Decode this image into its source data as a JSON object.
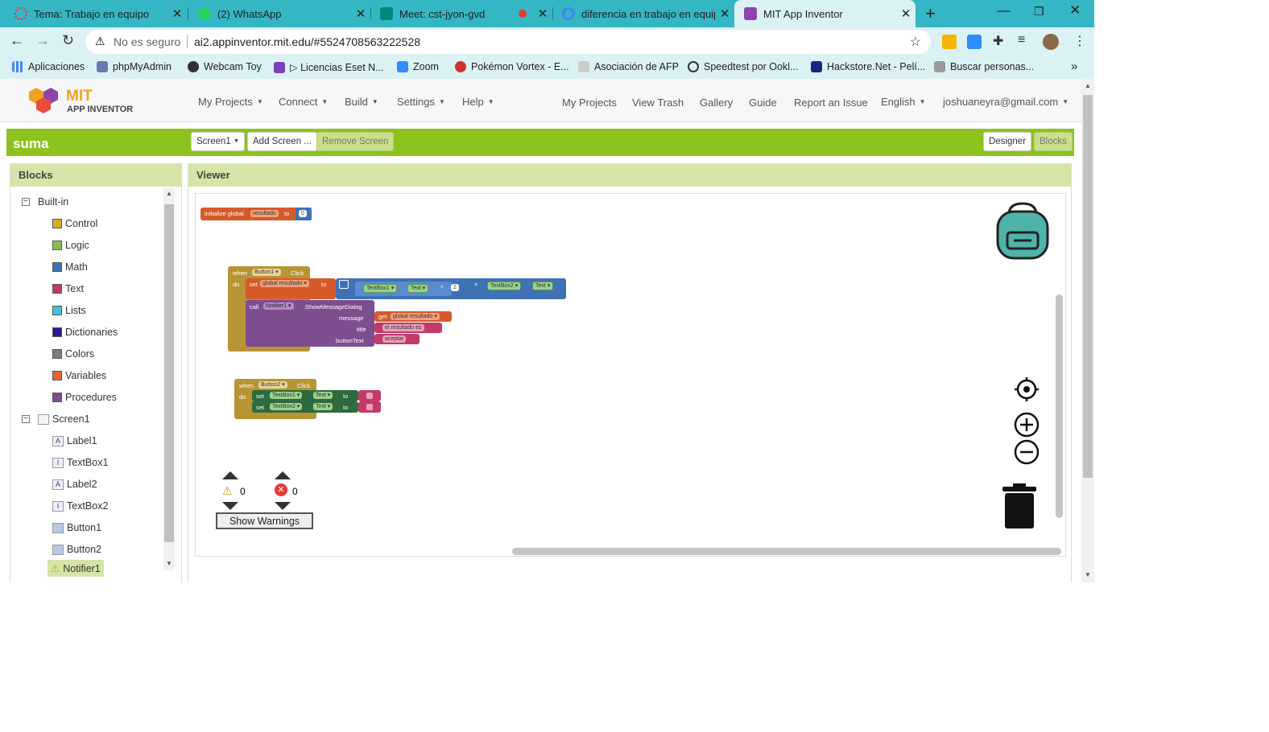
{
  "tabs": [
    {
      "title": "Tema: Trabajo en equipo",
      "icon": "loading-icon"
    },
    {
      "title": "(2) WhatsApp",
      "icon": "whatsapp-icon"
    },
    {
      "title": "Meet: cst-jyon-gvd",
      "icon": "meet-icon"
    },
    {
      "title": "diferencia en trabajo en equipo",
      "icon": "google-icon"
    },
    {
      "title": "MIT App Inventor",
      "icon": "appinventor-icon"
    }
  ],
  "address": {
    "security": "No es seguro",
    "url": "ai2.appinventor.mit.edu/#5524708563222528"
  },
  "bookmarks": [
    "Aplicaciones",
    "phpMyAdmin",
    "Webcam Toy",
    "▷ Licencias Eset N...",
    "Zoom",
    "Pokémon Vortex - E...",
    "Asociación de AFP",
    "Speedtest por Ookl...",
    "Hackstore.Net - Pelí...",
    "Buscar personas..."
  ],
  "app": {
    "logo_top": "MIT",
    "logo_bottom": "APP INVENTOR",
    "menus": [
      "My Projects",
      "Connect",
      "Build",
      "Settings",
      "Help"
    ],
    "links": [
      "My Projects",
      "View Trash",
      "Gallery",
      "Guide",
      "Report an Issue"
    ],
    "language": "English",
    "user": "joshuaneyra@gmail.com"
  },
  "project": {
    "name": "suma",
    "screen": "Screen1",
    "add_screen": "Add Screen ...",
    "remove_screen": "Remove Screen",
    "designer": "Designer",
    "blocks": "Blocks"
  },
  "blocks_panel": {
    "title": "Blocks",
    "builtin": "Built-in",
    "categories": [
      {
        "label": "Control",
        "color": "#e0a82e"
      },
      {
        "label": "Logic",
        "color": "#8cbd4a"
      },
      {
        "label": "Math",
        "color": "#3f71b5"
      },
      {
        "label": "Text",
        "color": "#c33969"
      },
      {
        "label": "Lists",
        "color": "#4ac0d6"
      },
      {
        "label": "Dictionaries",
        "color": "#2d1799"
      },
      {
        "label": "Colors",
        "color": "#7d7d7d"
      },
      {
        "label": "Variables",
        "color": "#e4662f"
      },
      {
        "label": "Procedures",
        "color": "#7c4d8f"
      }
    ],
    "screen": "Screen1",
    "components": [
      "Label1",
      "TextBox1",
      "Label2",
      "TextBox2",
      "Button1",
      "Button2",
      "Notifier1"
    ]
  },
  "viewer": {
    "title": "Viewer",
    "warnings_count": "0",
    "errors_count": "0",
    "show_warnings": "Show Warnings"
  },
  "code_blocks": {
    "init_global": "initialize global",
    "var_name": "resultado",
    "to": "to",
    "zero": "0",
    "when": "when",
    "do": "do",
    "button1": "Button1",
    "button2": "Button2",
    "click": ".Click",
    "set": "set",
    "global_resultado": "global resultado",
    "textbox1": "TextBox1",
    "textbox2": "TextBox2",
    "text_prop": "Text",
    "pow": "^",
    "two": "2",
    "times": "×",
    "call": "call",
    "notifier": "Notifier1",
    "show_dialog": ".ShowMessageDialog",
    "message": "message",
    "get": "get",
    "title": "title",
    "title_text": "el resultado es",
    "button_text": "buttonText",
    "button_text_value": "aceptar",
    "dot": "."
  }
}
